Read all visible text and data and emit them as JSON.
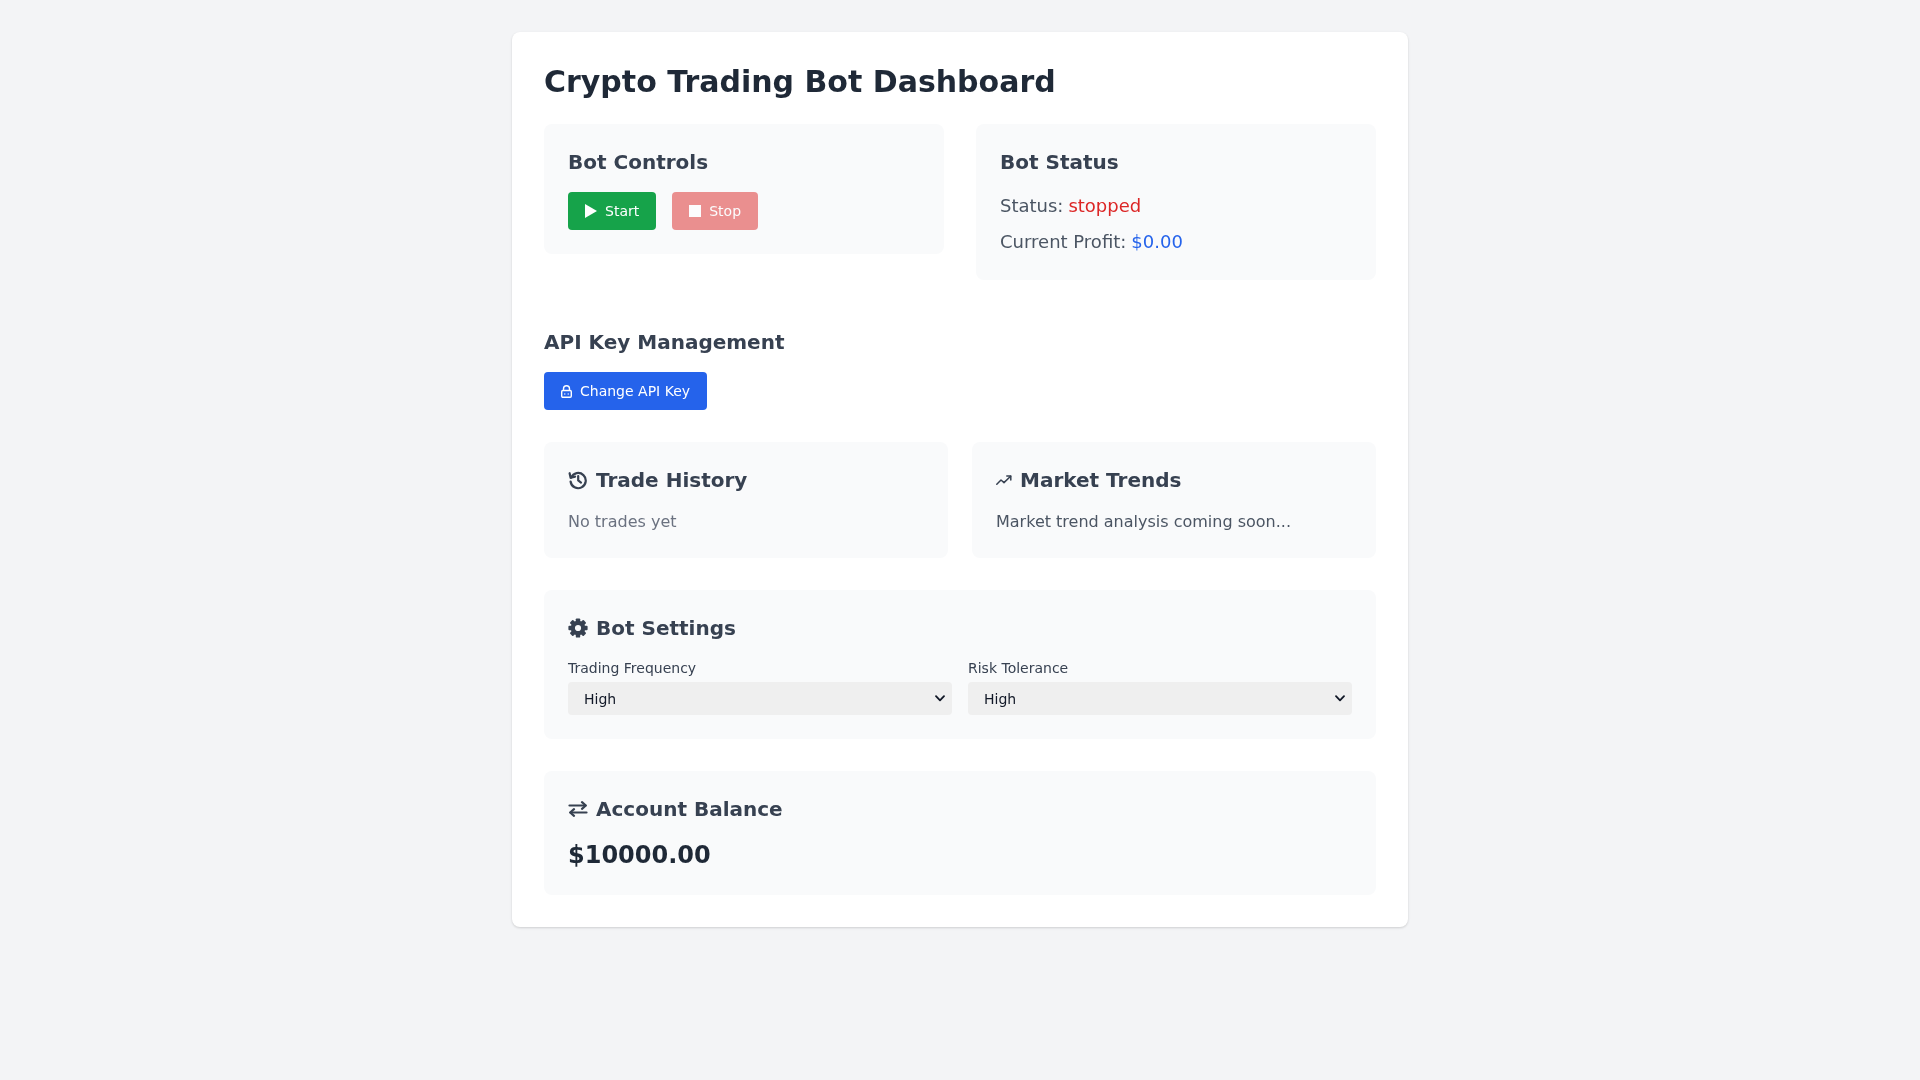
{
  "title": "Crypto Trading Bot Dashboard",
  "bot_controls": {
    "heading": "Bot Controls",
    "buttons": [
      {
        "kind": "start",
        "label": "Start",
        "disabled": false
      },
      {
        "kind": "stop",
        "label": "Stop",
        "disabled": true
      }
    ]
  },
  "bot_status": {
    "heading": "Bot Status",
    "fields": [
      {
        "label": "Status:",
        "value": "stopped",
        "color": "#dc2626"
      },
      {
        "label": "Current Profit:",
        "value": "$0.00",
        "color": "#2563eb"
      }
    ]
  },
  "api_key_management": {
    "heading": "API Key Management",
    "button": {
      "label": "Change API Key"
    }
  },
  "trade_history": {
    "heading": "Trade History",
    "message": "No trades yet"
  },
  "market_trends": {
    "heading": "Market Trends",
    "message": "Market trend analysis coming soon..."
  },
  "bot_settings": {
    "heading": "Bot Settings",
    "fields": [
      {
        "label": "Trading Frequency",
        "value": "High"
      },
      {
        "label": "Risk Tolerance",
        "value": "High"
      }
    ]
  },
  "account_balance": {
    "heading": "Account Balance",
    "value": "$10000.00"
  }
}
